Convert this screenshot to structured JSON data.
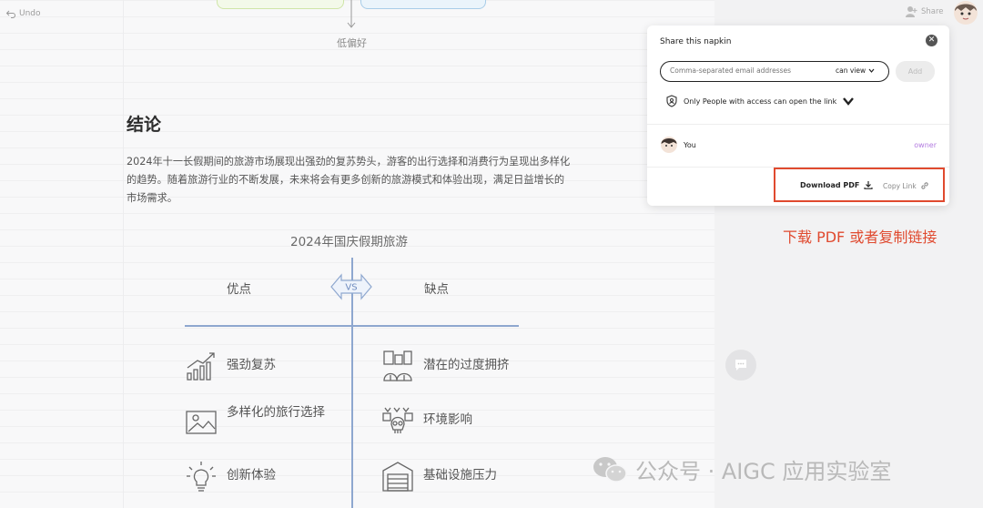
{
  "toolbar": {
    "undo_label": "Undo"
  },
  "diagram_top": {
    "caption": "低偏好"
  },
  "conclusion": {
    "title": "结论",
    "text": "2024年十一长假期间的旅游市场展现出强劲的复苏势头，游客的出行选择和消费行为呈现出多样化的趋势。随着旅游行业的不断发展，未来将会有更多创新的旅游模式和体验出现，满足日益增长的市场需求。"
  },
  "vs_diagram": {
    "title": "2024年国庆假期旅游",
    "badge": "VS",
    "pros_label": "优点",
    "cons_label": "缺点",
    "pros": [
      {
        "icon": "chart-growth-icon",
        "text": "强劲复苏"
      },
      {
        "icon": "picture-icon",
        "text": "多样化的旅行选择"
      },
      {
        "icon": "lightbulb-icon",
        "text": "创新体验"
      }
    ],
    "cons": [
      {
        "icon": "crowd-buildings-icon",
        "text": "潜在的过度拥挤"
      },
      {
        "icon": "skull-environment-icon",
        "text": "环境影响"
      },
      {
        "icon": "garage-icon",
        "text": "基础设施压力"
      }
    ],
    "line_color": "#8ea7cf"
  },
  "header": {
    "share_label": "Share"
  },
  "share_dialog": {
    "title": "Share this napkin",
    "email_placeholder": "Comma-separated email addresses",
    "permission": "can view",
    "add_label": "Add",
    "access_text": "Only People with access can open the link",
    "user_name": "You",
    "user_role": "owner",
    "download_label": "Download PDF",
    "copy_label": "Copy Link"
  },
  "annotation": {
    "text": "下载 PDF 或者复制链接",
    "color": "#e04a2f"
  },
  "watermark": {
    "text": "公众号 · AIGC 应用实验室"
  }
}
